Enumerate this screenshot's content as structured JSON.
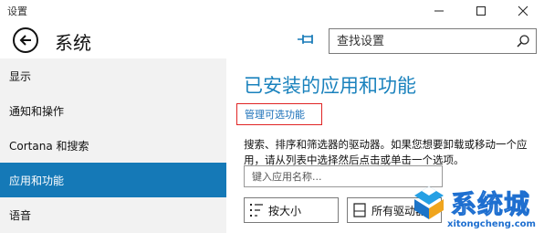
{
  "window": {
    "title": "设置"
  },
  "header": {
    "title": "系统",
    "search_placeholder": "查找设置"
  },
  "sidebar": {
    "items": [
      {
        "label": "显示"
      },
      {
        "label": "通知和操作"
      },
      {
        "label": "Cortana 和搜索"
      },
      {
        "label": "应用和功能",
        "active": true
      },
      {
        "label": "语音"
      }
    ]
  },
  "content": {
    "title": "已安装的应用和功能",
    "manage_link": "管理可选功能",
    "description": "搜索、排序和筛选器的驱动器。如果您想要卸载或移动一个应用，请从列表中选择然后点击或单击一个选项。",
    "app_search_placeholder": "键入应用名称...",
    "sort_button": "按大小",
    "drive_button": "所有驱动器"
  },
  "watermark": {
    "brand": "系统城",
    "url": "xitongcheng.com"
  },
  "colors": {
    "accent": "#1579b7",
    "title_blue": "#1a82bd",
    "highlight_red": "#e02424"
  }
}
